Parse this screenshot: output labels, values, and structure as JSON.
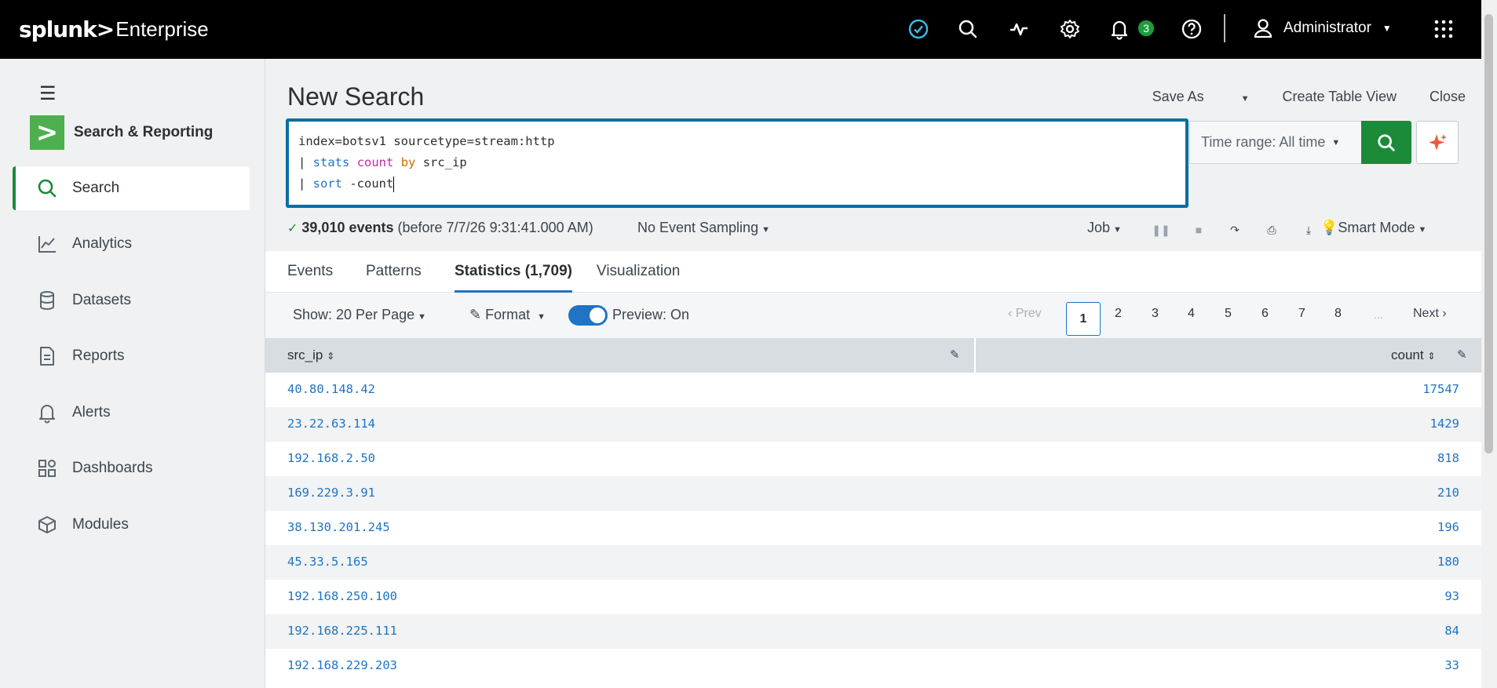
{
  "topbar": {
    "brand": "splunk>",
    "product": "Enterprise",
    "notification_count": "3",
    "user_name": "Administrator"
  },
  "sidebar": {
    "app_name": "Search & Reporting",
    "items": [
      {
        "label": "Search",
        "icon": "search-icon",
        "active": true
      },
      {
        "label": "Analytics",
        "icon": "chart-line-icon"
      },
      {
        "label": "Datasets",
        "icon": "database-icon"
      },
      {
        "label": "Reports",
        "icon": "document-icon"
      },
      {
        "label": "Alerts",
        "icon": "bell-icon"
      },
      {
        "label": "Dashboards",
        "icon": "dashboard-icon"
      },
      {
        "label": "Modules",
        "icon": "modules-icon"
      }
    ]
  },
  "header": {
    "title": "New Search",
    "save_as": "Save As",
    "create_table_view": "Create Table View",
    "close": "Close"
  },
  "search": {
    "line1": "index=botsv1 sourcetype=stream:http",
    "line2_pipe": "| ",
    "line2_cmd": "stats",
    "line2_func": "count",
    "line2_by": "by",
    "line2_rest": "src_ip",
    "line3_pipe": "| ",
    "line3_cmd": "sort",
    "line3_rest": "-count",
    "time_range": "Time range: All time"
  },
  "status": {
    "events": "39,010 events",
    "before": "(before 7/7/26 9:31:41.000 AM)",
    "sampling": "No Event Sampling",
    "job": "Job",
    "mode": "Smart Mode"
  },
  "tabs": [
    {
      "label": "Events"
    },
    {
      "label": "Patterns"
    },
    {
      "label": "Statistics (1,709)",
      "active": true
    },
    {
      "label": "Visualization"
    }
  ],
  "controls": {
    "show": "Show: 20 Per Page",
    "format": "Format",
    "preview": "Preview: On",
    "preview_on": true
  },
  "pager": {
    "prev": "Prev",
    "pages": [
      "1",
      "2",
      "3",
      "4",
      "5",
      "6",
      "7",
      "8"
    ],
    "current": "1",
    "ellipsis": "...",
    "next": "Next"
  },
  "table": {
    "columns": [
      "src_ip",
      "count"
    ],
    "rows": [
      {
        "src_ip": "40.80.148.42",
        "count": "17547"
      },
      {
        "src_ip": "23.22.63.114",
        "count": "1429"
      },
      {
        "src_ip": "192.168.2.50",
        "count": "818"
      },
      {
        "src_ip": "169.229.3.91",
        "count": "210"
      },
      {
        "src_ip": "38.130.201.245",
        "count": "196"
      },
      {
        "src_ip": "45.33.5.165",
        "count": "180"
      },
      {
        "src_ip": "192.168.250.100",
        "count": "93"
      },
      {
        "src_ip": "192.168.225.111",
        "count": "84"
      },
      {
        "src_ip": "192.168.229.203",
        "count": "33"
      }
    ]
  },
  "colors": {
    "accent_green": "#1b8b3a",
    "accent_blue": "#1f74c4",
    "topbar": "#000000",
    "sidebar": "#eff1f2"
  }
}
